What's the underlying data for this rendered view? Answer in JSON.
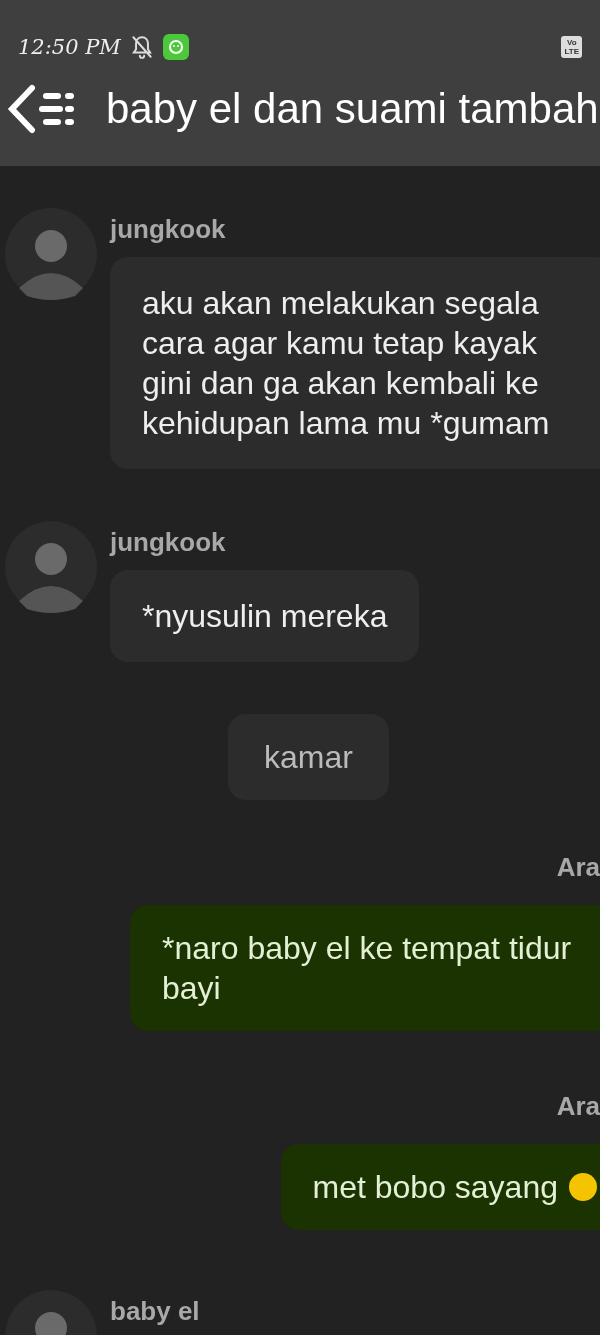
{
  "status_bar": {
    "time": "12:50 PM",
    "badge_top": "Vo",
    "badge_bottom": "LTE"
  },
  "header": {
    "title": "baby el dan suami tambah"
  },
  "messages": [
    {
      "kind": "incoming",
      "sender": "jungkook",
      "text": "aku akan melakukan segala cara agar kamu tetap kayak gini dan ga akan kembali ke kehidupan lama mu *gumam"
    },
    {
      "kind": "incoming",
      "sender": "jungkook",
      "text": "*nyusulin mereka"
    },
    {
      "kind": "narration",
      "text": "kamar"
    },
    {
      "kind": "outgoing",
      "sender": "Ara",
      "text": "*naro baby el ke tempat tidur bayi"
    },
    {
      "kind": "outgoing",
      "sender": "Ara",
      "text": "met bobo sayang",
      "emoji": true
    },
    {
      "kind": "incoming",
      "sender": "baby el"
    }
  ]
}
